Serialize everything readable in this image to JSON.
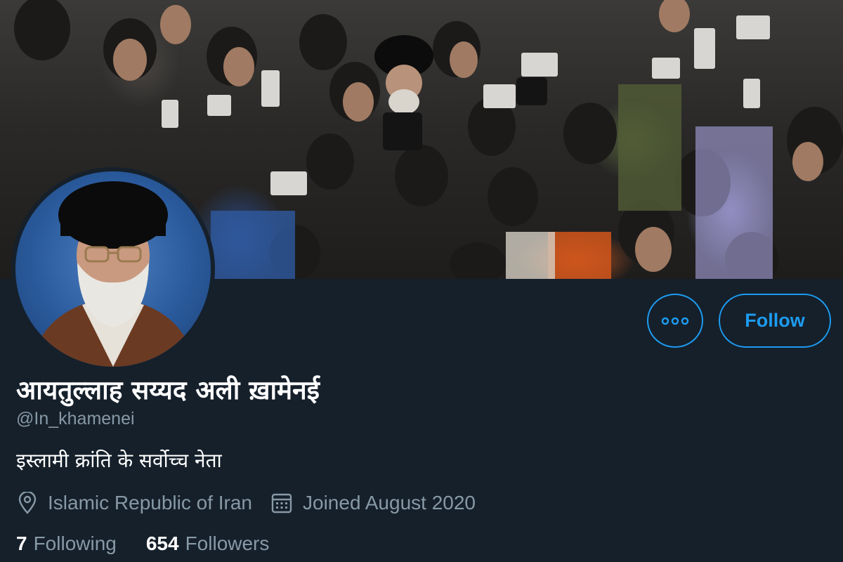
{
  "profile": {
    "display_name": "आयतुल्लाह सय्यद अली ख़ामेनई",
    "handle": "@In_khamenei",
    "bio": "इस्लामी क्रांति के सर्वोच्च नेता",
    "location": "Islamic Republic of Iran",
    "joined": "Joined August 2020"
  },
  "actions": {
    "follow_label": "Follow",
    "more_icon": "more-dots-icon"
  },
  "stats": {
    "following_count": "7",
    "following_label": "Following",
    "followers_count": "654",
    "followers_label": "Followers"
  },
  "icons": {
    "location": "location-pin-icon",
    "calendar": "calendar-icon"
  },
  "colors": {
    "background": "#15202b",
    "accent": "#1d9bf0",
    "secondary_text": "#8899a6",
    "primary_text": "#ffffff"
  }
}
